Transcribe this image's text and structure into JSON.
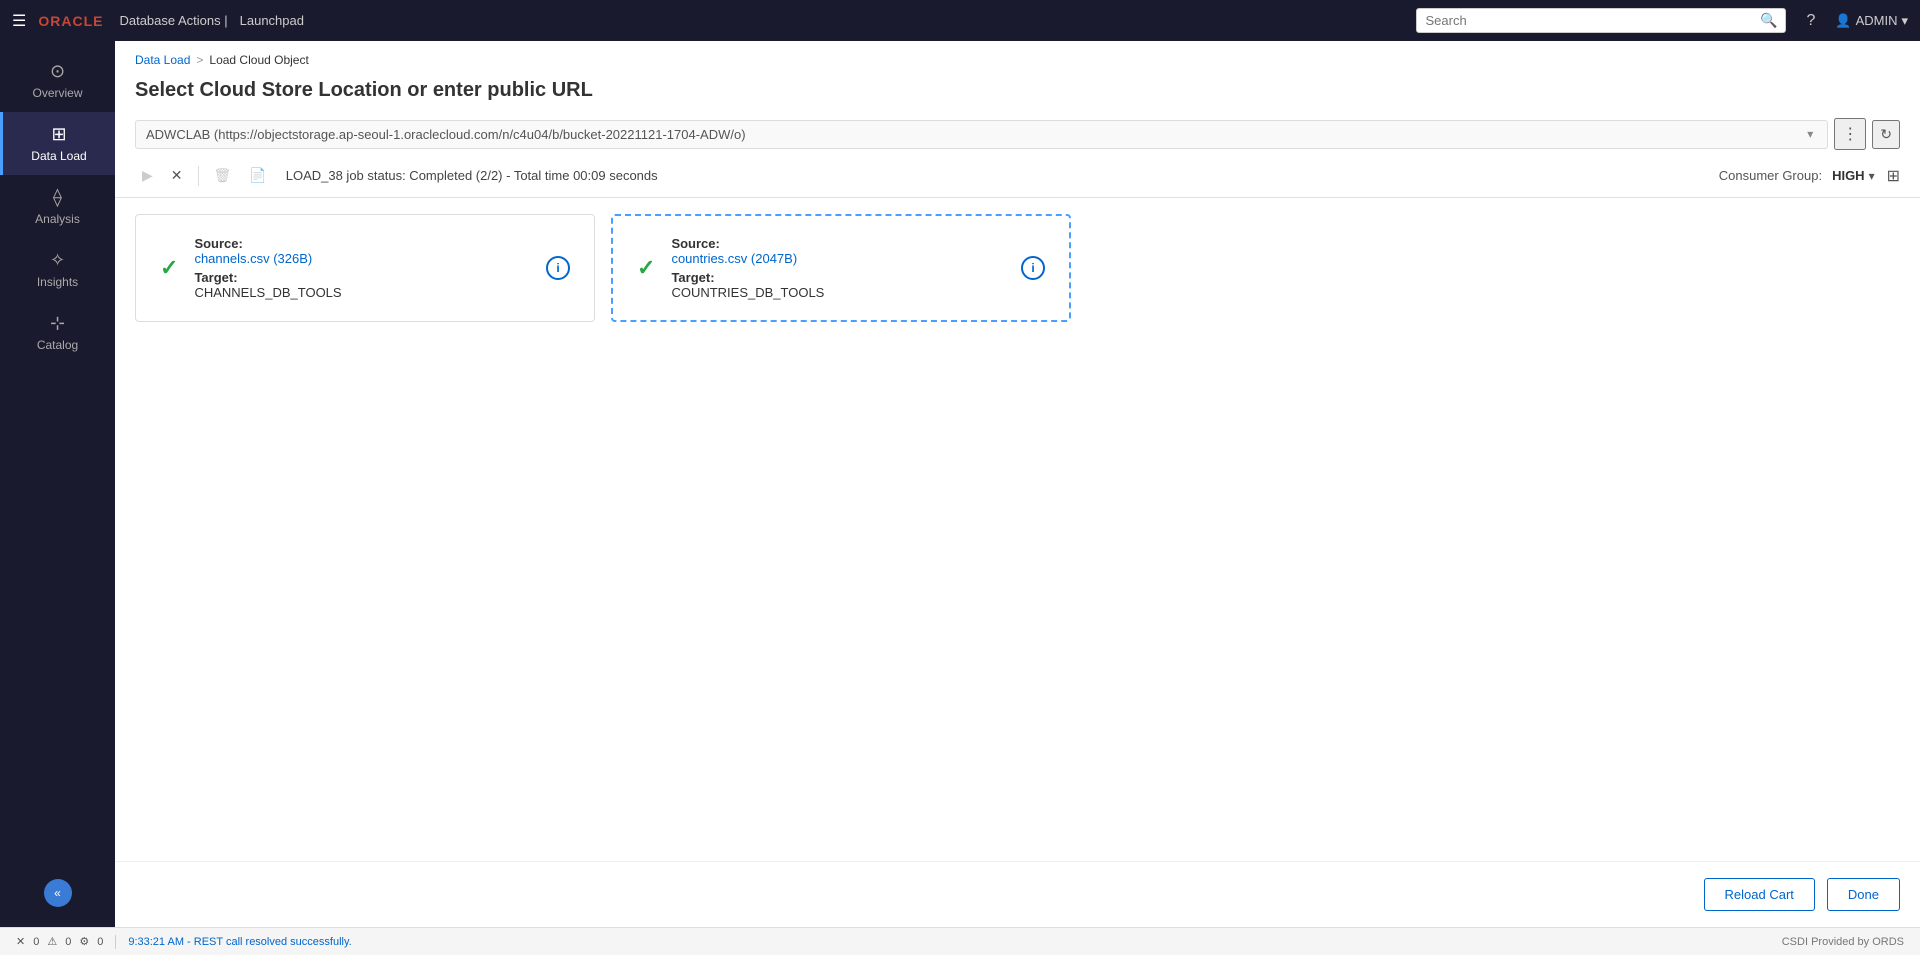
{
  "app": {
    "oracle_label": "ORACLE",
    "app_title": "Database Actions |",
    "launchpad": "Launchpad"
  },
  "search": {
    "placeholder": "Search"
  },
  "user": {
    "label": "ADMIN"
  },
  "sidebar": {
    "items": [
      {
        "id": "overview",
        "label": "Overview",
        "icon": "⊙"
      },
      {
        "id": "data-load",
        "label": "Data Load",
        "icon": "⊞",
        "active": true
      },
      {
        "id": "analysis",
        "label": "Analysis",
        "icon": "⟠"
      },
      {
        "id": "insights",
        "label": "Insights",
        "icon": "✧"
      },
      {
        "id": "catalog",
        "label": "Catalog",
        "icon": "⊹"
      }
    ],
    "collapse_icon": "«"
  },
  "breadcrumb": {
    "parent": "Data Load",
    "separator": ">",
    "current": "Load Cloud Object"
  },
  "page": {
    "title": "Select Cloud Store Location or enter public URL"
  },
  "url_bar": {
    "value": "ADWCLAB (https://objectstorage.ap-seoul-1.oraclecloud.com/n/c4u04/b/bucket-20221121-1704-ADW/o)"
  },
  "toolbar": {
    "job_status": "LOAD_38 job status: Completed (2/2) - Total time 00:09 seconds",
    "consumer_group_label": "Consumer Group:",
    "consumer_group_value": "HIGH",
    "play_btn": "▶",
    "stop_btn": "✕",
    "delete_btn": "🗑",
    "file_btn": "📄"
  },
  "cards": [
    {
      "id": "card1",
      "selected": false,
      "source_label": "Source:",
      "source_value": "channels.csv (326B)",
      "target_label": "Target:",
      "target_value": "CHANNELS_DB_TOOLS"
    },
    {
      "id": "card2",
      "selected": true,
      "source_label": "Source:",
      "source_value": "countries.csv (2047B)",
      "target_label": "Target:",
      "target_value": "COUNTRIES_DB_TOOLS"
    }
  ],
  "actions": {
    "reload_cart": "Reload Cart",
    "done": "Done"
  },
  "status_bar": {
    "error_count": "0",
    "warning_count": "0",
    "settings_count": "0",
    "separator": "|",
    "message": "9:33:21 AM - REST call resolved successfully.",
    "right_text": "CSDI Provided by ORDS"
  }
}
